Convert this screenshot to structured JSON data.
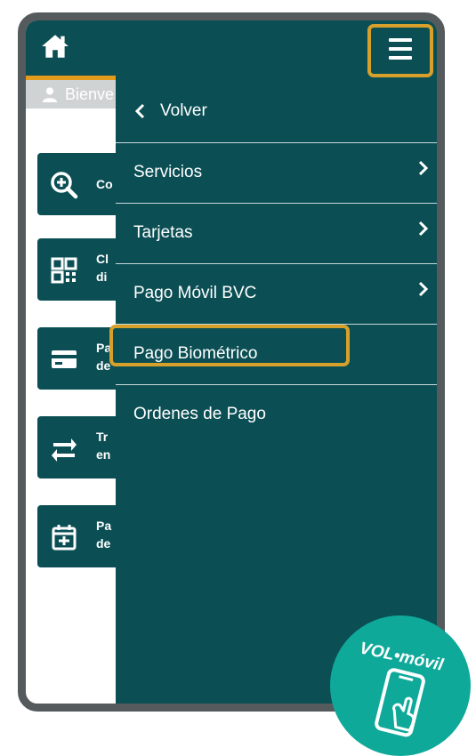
{
  "colors": {
    "primary": "#0b4f55",
    "accent": "#e39b1b",
    "highlight": "#d6a02a",
    "badge": "#0fa99a"
  },
  "header": {
    "home_icon": "home-icon",
    "menu_icon": "hamburger-icon"
  },
  "welcome": {
    "text": "Bienve"
  },
  "cards": [
    {
      "icon": "magnifier-plus-icon",
      "line1": "Co",
      "line2": ""
    },
    {
      "icon": "qr-code-icon",
      "line1": "Cl",
      "line2": "di"
    },
    {
      "icon": "credit-card-icon",
      "line1": "Pa",
      "line2": "de"
    },
    {
      "icon": "transfer-arrows-icon",
      "line1": "Tr",
      "line2": "en"
    },
    {
      "icon": "calendar-plus-icon",
      "line1": "Pa",
      "line2": "de"
    }
  ],
  "menu": {
    "back_label": "Volver",
    "items": [
      {
        "label": "Servicios"
      },
      {
        "label": "Tarjetas"
      },
      {
        "label": "Pago Móvil BVC"
      },
      {
        "label": "Pago Biométrico"
      },
      {
        "label": "Ordenes de Pago"
      }
    ]
  },
  "badge": {
    "text": "VOL•móvil",
    "icon": "phone-tap-icon"
  }
}
